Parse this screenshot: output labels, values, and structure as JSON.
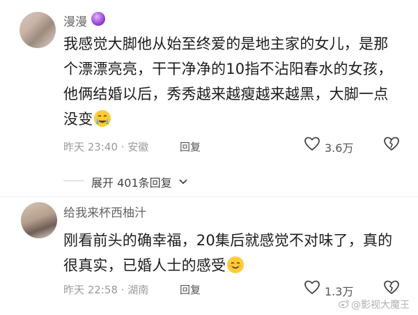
{
  "comment1": {
    "username": "漫漫",
    "text_line1": "我感觉大脚他从始至终爱的是地主家的女儿，是那",
    "text_line2": "个漂漂亮亮，干干净净的10指不沾阳春水的女孩，",
    "text_line3": "他俩结婚以后，秀秀越来越瘦越来越黑，大脚一点",
    "text_line4": "没变",
    "meta": "昨天 23:40 · 安徽",
    "reply_label": "回复",
    "like_count": "3.6万",
    "emoji_icon": "crying-emoji-icon"
  },
  "expand_replies": {
    "label": "展开 401条回复"
  },
  "comment2": {
    "username": "给我来杯西柚汁",
    "text_line1": "刚看前头的确幸福，20集后就感觉不对味了，真的",
    "text_line2": "很真实，已婚人士的感受",
    "meta": "昨天 22:58 · 湖南",
    "reply_label": "回复",
    "like_count": "1.3万",
    "emoji_icon": "smiling-emoji-icon"
  },
  "watermark": {
    "text": "@影视大魔王"
  },
  "colors": {
    "badge": "#9d4ad8",
    "emoji": "#ffcc33"
  }
}
